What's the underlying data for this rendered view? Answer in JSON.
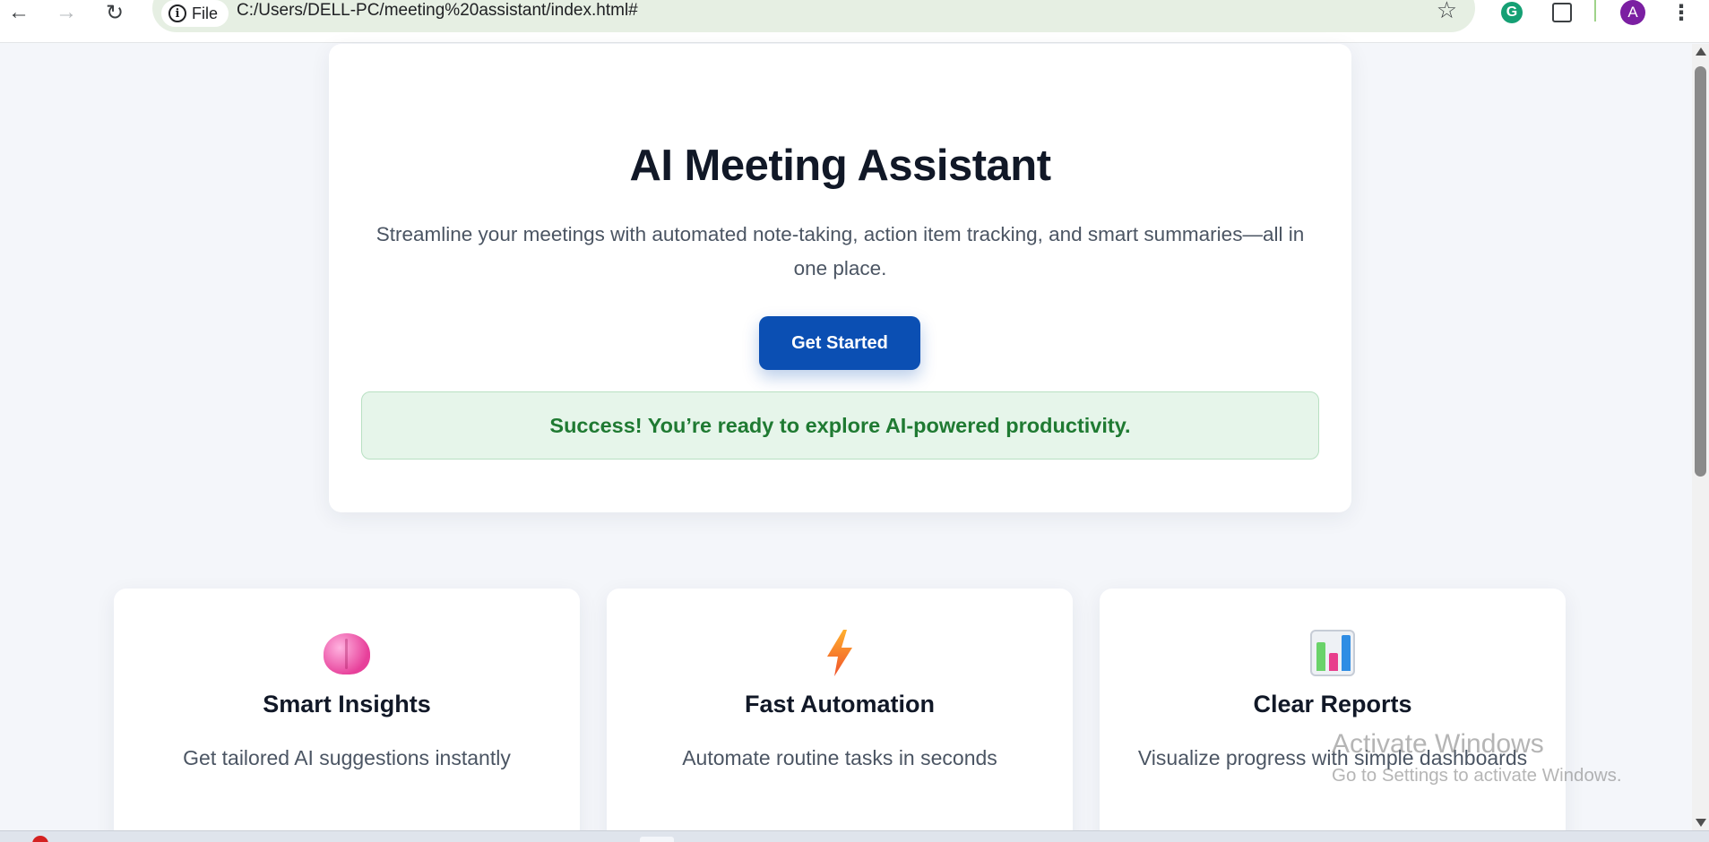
{
  "browser": {
    "address_chip_label": "File",
    "url": "C:/Users/DELL-PC/meeting%20assistant/index.html#",
    "extension_letter": "G",
    "profile_initial": "A"
  },
  "hero": {
    "title": "AI Meeting Assistant",
    "description": "Streamline your meetings with automated note-taking, action item tracking, and smart summaries—all in one place.",
    "cta_label": "Get Started",
    "success_message": "Success! You’re ready to explore AI-powered productivity."
  },
  "features": [
    {
      "icon": "brain-icon",
      "title": "Smart Insights",
      "description": "Get tailored AI suggestions instantly"
    },
    {
      "icon": "lightning-icon",
      "title": "Fast Automation",
      "description": "Automate routine tasks in seconds"
    },
    {
      "icon": "bar-chart-icon",
      "title": "Clear Reports",
      "description": "Visualize progress with simple dashboards"
    }
  ],
  "watermark": {
    "line1": "Activate Windows",
    "line2": "Go to Settings to activate Windows."
  },
  "colors": {
    "primary_button": "#0b4fb3",
    "success_text": "#1f7a32",
    "success_bg": "#e6f5ea",
    "page_bg": "#f4f6fa"
  }
}
